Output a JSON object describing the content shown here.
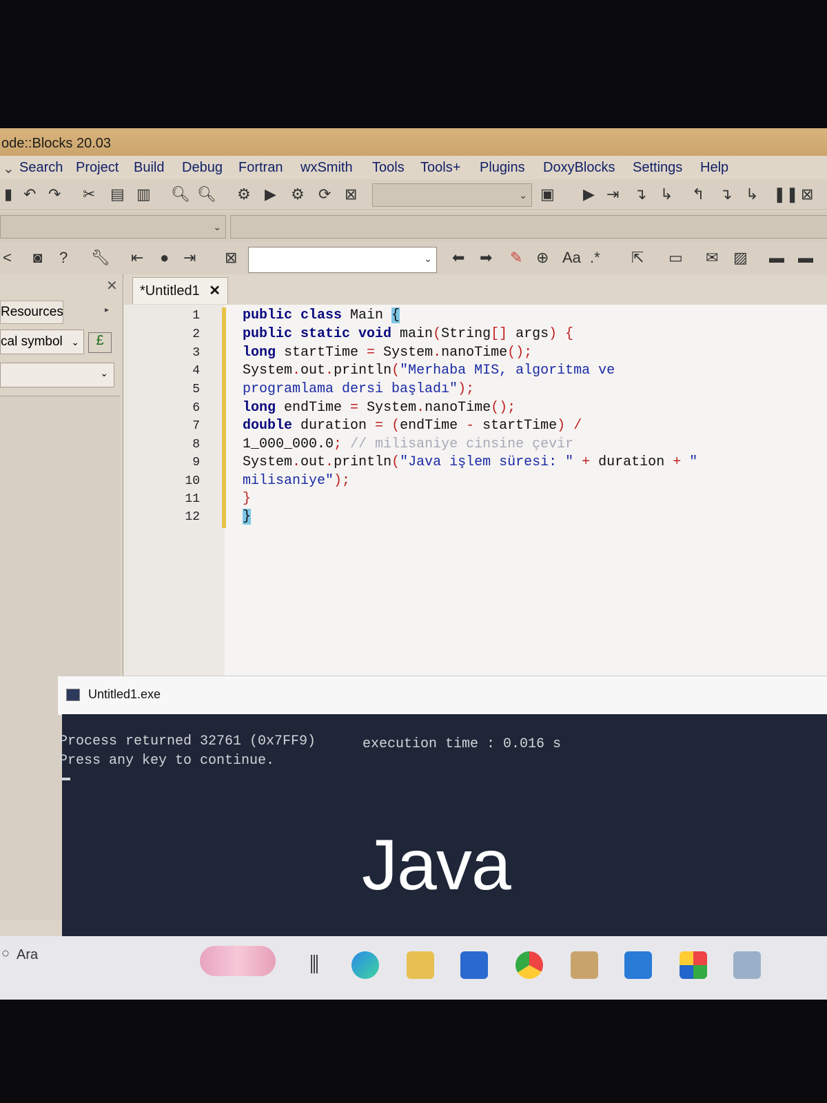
{
  "window": {
    "title": "ode::Blocks 20.03"
  },
  "menu": [
    "Search",
    "Project",
    "Build",
    "Debug",
    "Fortran",
    "wxSmith",
    "Tools",
    "Tools+",
    "Plugins",
    "DoxyBlocks",
    "Settings",
    "Help"
  ],
  "left_panel": {
    "tab_label": "Resources",
    "combo_label": "cal symbol"
  },
  "editor": {
    "tab_label": "*Untitled1",
    "line_numbers": [
      "1",
      "2",
      "3",
      "4",
      "5",
      "6",
      "7",
      "8",
      "9",
      "10",
      "11",
      "12"
    ]
  },
  "console": {
    "title": "Untitled1.exe",
    "line1": "Process returned 32761 (0x7FF9)",
    "exec": "execution time : 0.016 s",
    "line2": "Press any key to continue."
  },
  "overlay_text": "Java",
  "taskbar": {
    "search_label": "Ara"
  }
}
